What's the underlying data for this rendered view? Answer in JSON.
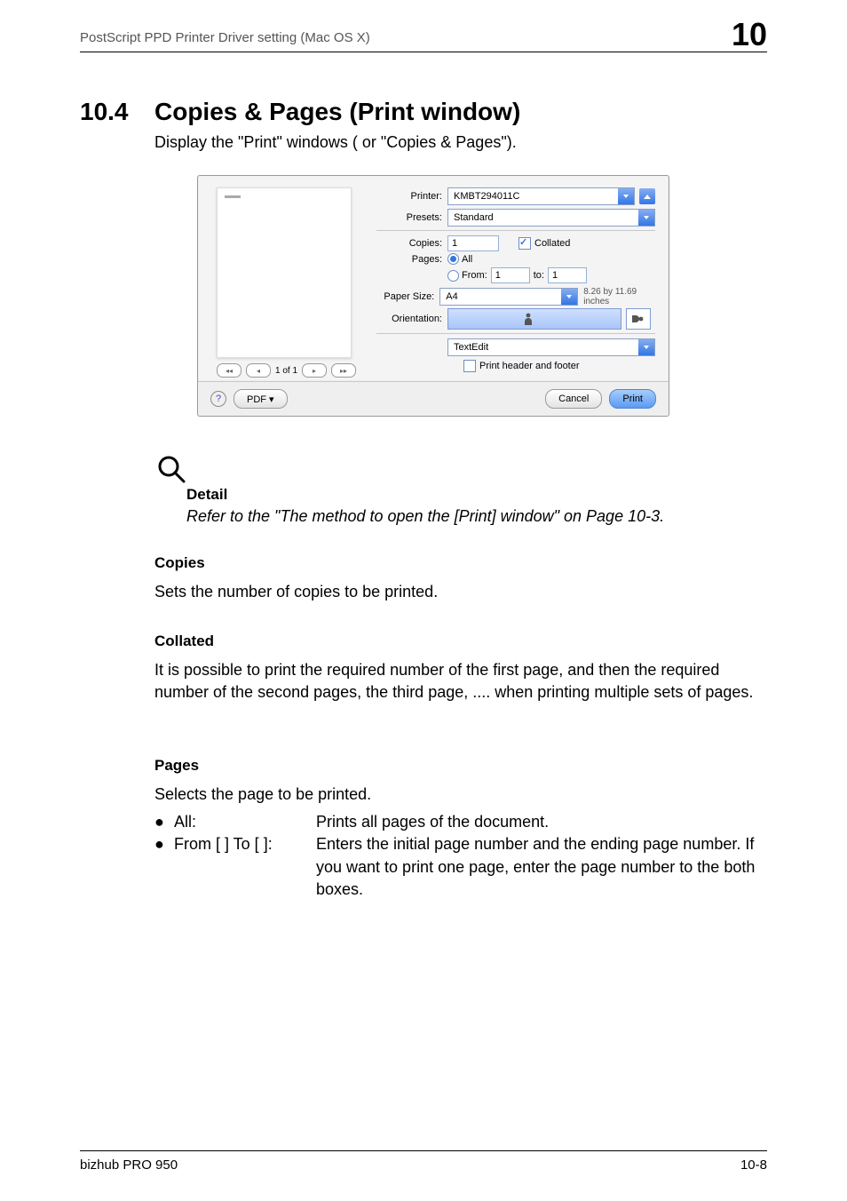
{
  "header": {
    "left": "PostScript PPD Printer Driver setting (Mac OS X)",
    "right": "10"
  },
  "title": {
    "num": "10.4",
    "text": "Copies & Pages (Print window)"
  },
  "intro": "Display the \"Print\" windows ( or \"Copies & Pages\").",
  "dialog": {
    "printer_label": "Printer:",
    "printer_value": "KMBT294011C",
    "presets_label": "Presets:",
    "presets_value": "Standard",
    "copies_label": "Copies:",
    "copies_value": "1",
    "collated_label": "Collated",
    "pages_label": "Pages:",
    "pages_all": "All",
    "pages_from_label": "From:",
    "pages_from_value": "1",
    "pages_to_label": "to:",
    "pages_to_value": "1",
    "paper_size_label": "Paper Size:",
    "paper_size_value": "A4",
    "paper_dim": "8.26 by 11.69 inches",
    "orientation_label": "Orientation:",
    "pane_value": "TextEdit",
    "header_footer_label": "Print header and footer",
    "pager_text": "1 of 1",
    "help_glyph": "?",
    "pdf_label": "PDF ▾",
    "cancel": "Cancel",
    "print": "Print"
  },
  "detail": {
    "title": "Detail",
    "body": "Refer to the \"The method to open the [Print] window\" on Page 10-3."
  },
  "copies": {
    "title": "Copies",
    "body": "Sets the number of copies to be printed."
  },
  "collated": {
    "title": "Collated",
    "body": "It is possible to print the required number of the first page, and then the required number of the second pages, the third page, .... when printing multiple sets of pages."
  },
  "pages": {
    "title": "Pages",
    "intro": "Selects the page to be printed.",
    "b1key": "All:",
    "b1val": "Prints all pages of the document.",
    "b2key": "From [   ] To [   ]:",
    "b2val": "Enters the initial page number and the ending page number. If you want to print one page, enter the page number to the both boxes."
  },
  "footer": {
    "left": "bizhub PRO 950",
    "right": "10-8"
  }
}
